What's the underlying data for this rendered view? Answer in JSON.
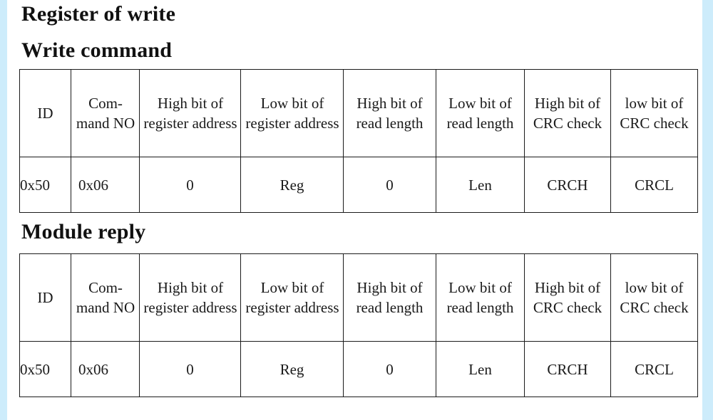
{
  "document": {
    "title": "Register of write"
  },
  "sections": [
    {
      "id": "write-command",
      "heading": "Write command",
      "table": {
        "headers": [
          "ID",
          "Com-mand NO",
          "High bit of register address",
          "Low bit of register address",
          "High bit of read length",
          "Low bit of read length",
          "High bit of CRC check",
          "low bit of CRC check"
        ],
        "rows": [
          [
            "0x50",
            "0x06",
            "0",
            "Reg",
            "0",
            "Len",
            "CRCH",
            "CRCL"
          ]
        ]
      }
    },
    {
      "id": "module-reply",
      "heading": "Module reply",
      "table": {
        "headers": [
          "ID",
          "Com-mand NO",
          "High bit of register address",
          "Low bit of register address",
          "High bit of read length",
          "Low bit of read length",
          "High bit of CRC check",
          "low bit of CRC check"
        ],
        "rows": [
          [
            "0x50",
            "0x06",
            "0",
            "Reg",
            "0",
            "Len",
            "CRCH",
            "CRCL"
          ]
        ]
      }
    }
  ],
  "theme": {
    "page_background": "#ffffff",
    "edge_strip_color": "#cdecfb",
    "text_color": "#1a1a1a",
    "table_border_color": "#1b1b1b"
  }
}
